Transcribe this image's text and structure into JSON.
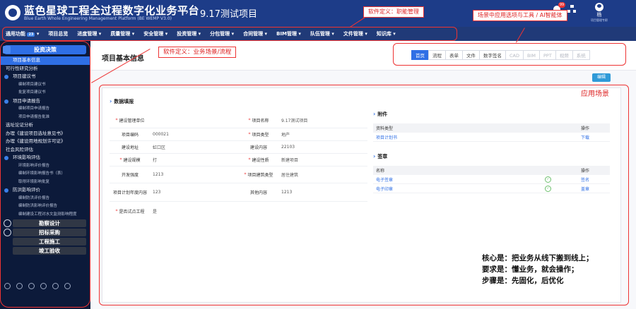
{
  "header": {
    "app_title": "蓝色星球工程全过程数字化业务平台",
    "app_subtitle": "Blue Earth Whole Engineering Management Platform (BE WEMP V3.0)",
    "project_title": "9.17测试项目",
    "notification_count": "99",
    "user_name": "杨",
    "user_role": "项目管理专职"
  },
  "annotations": {
    "function_label": "软件定义：职能管理",
    "scene_options_label": "场景中应用选项与工具 / AI智能体",
    "business_label": "软件定义：业务场景/流程",
    "app_scene_label": "应用场景"
  },
  "menu": {
    "items": [
      {
        "label": "通用功能",
        "num": "23"
      },
      {
        "label": "项目总览"
      },
      {
        "label": "进度管理"
      },
      {
        "label": "质量管理"
      },
      {
        "label": "安全管理"
      },
      {
        "label": "投资管理"
      },
      {
        "label": "分包管理"
      },
      {
        "label": "合同管理"
      },
      {
        "label": "BIM管理"
      },
      {
        "label": "队伍管理"
      },
      {
        "label": "文件管理"
      },
      {
        "label": "知识库"
      }
    ]
  },
  "sidebar": {
    "header": "投资决策",
    "items": [
      "项目基本信息",
      "可行性研究分析",
      "项目建议书",
      "编制项目建议书",
      "批复项目建议书",
      "项目申请报告",
      "编制项目申请报告",
      "项目申请报告批准",
      "选址论证分析",
      "办理《建设项目选址意见书》",
      "办理《建设用地规划许可证》",
      "社会风险评估",
      "环境影响评估",
      "环境影响评价报告",
      "编制环境影响报告书（表）",
      "取得环境影响批复",
      "防洪影响评价",
      "编制防洪评价报告",
      "编制防洪影响评价报告",
      "编制建设工程对水文监测影响程度"
    ],
    "sections": [
      "勘察设计",
      "招标采购",
      "工程施工",
      "竣工验收"
    ]
  },
  "page": {
    "title": "项目基本信息",
    "tabs": [
      "首页",
      "流程",
      "表单",
      "文件",
      "数字签名",
      "CAD",
      "BIM",
      "PPT",
      "视频",
      "系统"
    ],
    "edit_label": "编辑"
  },
  "basic_info": {
    "section_title": "数据填报",
    "rows": [
      [
        {
          "label": "建设管理单位",
          "req": true,
          "value": ""
        },
        {
          "label": "项目名称",
          "req": true,
          "value": "9.17测试项目"
        }
      ],
      [
        {
          "label": "项目编码",
          "req": false,
          "value": "000021"
        },
        {
          "label": "项目类型",
          "req": true,
          "value": "地产"
        }
      ],
      [
        {
          "label": "建设地址",
          "req": false,
          "value": "虹口区"
        },
        {
          "label": "建设内容",
          "req": false,
          "value": "22103"
        }
      ],
      [
        {
          "label": "建设规模",
          "req": true,
          "value": "打"
        },
        {
          "label": "建设性质",
          "req": true,
          "value": "新建项目"
        }
      ],
      [
        {
          "label": "开发强度",
          "req": false,
          "value": "1213"
        },
        {
          "label": "项目建筑类型",
          "req": true,
          "value": "居住建筑"
        }
      ],
      [
        {
          "label": "项目计划年度内容",
          "req": false,
          "value": "123"
        },
        {
          "label": "其他内容",
          "req": false,
          "value": "1213"
        }
      ],
      [
        {
          "label": "是否试点工程",
          "req": true,
          "value": "是"
        }
      ]
    ]
  },
  "attachments": {
    "section_title": "附件",
    "col_type": "资料类型",
    "col_op": "操作",
    "rows": [
      {
        "name": "项目计划书",
        "op": "下载"
      }
    ]
  },
  "signatures": {
    "section_title": "签章",
    "col_name": "名称",
    "col_op": "操作",
    "rows": [
      {
        "name": "电子签章",
        "op": "签名"
      },
      {
        "name": "电子印章",
        "op": "盖章"
      }
    ]
  },
  "core_text": {
    "line1": "核心是：把业务从线下搬到线上；",
    "line2": "要求是：懂业务，就会操作；",
    "line3": "步骤是：先固化，后优化"
  },
  "colors": {
    "header_bg": "#1d3c88",
    "accent": "#2f6fe5",
    "annotation_red": "#e33333",
    "sidebar_bg": "#0c1a3a"
  }
}
